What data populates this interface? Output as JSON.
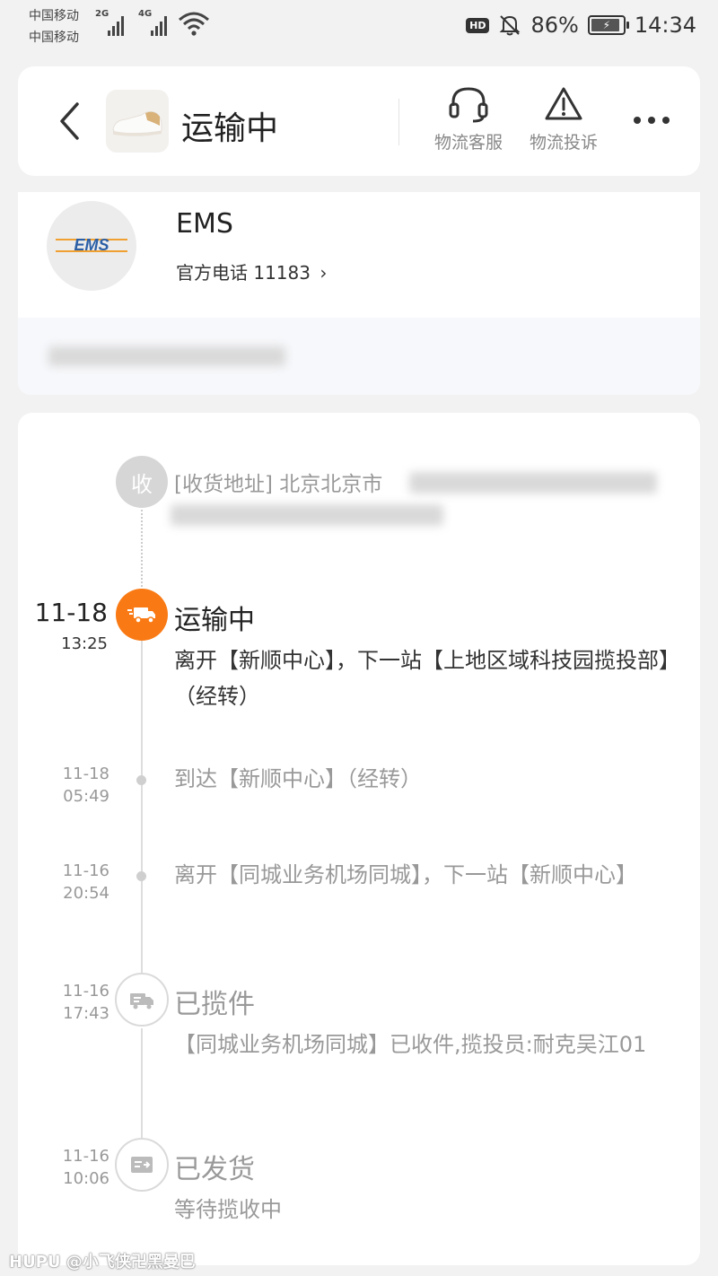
{
  "status_bar": {
    "carrier1": "中国移动",
    "carrier2": "中国移动",
    "net1": "2G",
    "net2": "4G",
    "battery": "86%",
    "time": "14:34",
    "hd": "HD"
  },
  "header": {
    "title": "运输中",
    "actions": [
      {
        "label": "物流客服",
        "icon": "headset-icon"
      },
      {
        "label": "物流投诉",
        "icon": "warning-icon"
      }
    ]
  },
  "courier": {
    "name": "EMS",
    "logo_text": "EMS",
    "phone": "官方电话 11183",
    "phone_chevron": "›"
  },
  "address": {
    "node_label": "收",
    "text": "[收货地址] 北京北京市"
  },
  "timeline": [
    {
      "date": "11-18",
      "time": "13:25",
      "status": "运输中",
      "detail": "离开【新顺中心】，下一站【上地区域科技园揽投部】（经转）",
      "icon": "truck-icon",
      "active": true
    },
    {
      "date": "11-18",
      "time": "05:49",
      "status": "",
      "detail": "到达【新顺中心】（经转）",
      "active": false
    },
    {
      "date": "11-16",
      "time": "20:54",
      "status": "",
      "detail": "离开【同城业务机场同城】，下一站【新顺中心】",
      "active": false
    },
    {
      "date": "11-16",
      "time": "17:43",
      "status": "已揽件",
      "detail": "【同城业务机场同城】已收件,揽投员:耐克吴江01",
      "icon": "pickup-icon",
      "active": false
    },
    {
      "date": "11-16",
      "time": "10:06",
      "status": "已发货",
      "detail": "等待揽收中",
      "icon": "shipped-icon",
      "active": false
    }
  ],
  "watermark": "HUPU @小飞侠卍黑曼巴",
  "colors": {
    "accent": "#f97a14",
    "muted": "#999999",
    "background": "#f2f2f2"
  }
}
